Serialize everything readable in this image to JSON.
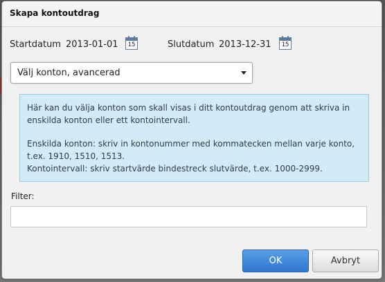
{
  "dialog": {
    "title": "Skapa kontoutdrag"
  },
  "dates": {
    "start_label": "Startdatum",
    "start_value": "2013-01-01",
    "end_label": "Slutdatum",
    "end_value": "2013-12-31",
    "calendar_icon_number": "15"
  },
  "account_select": {
    "selected": "Välj konton, avancerad"
  },
  "info": {
    "line1": "Här kan du välja konton som skall visas i ditt kontoutdrag genom att skriva in",
    "line2": "enskilda konton eller ett kontointervall.",
    "line3": "Enskilda konton: skriv in kontonummer med kommatecken mellan varje konto,",
    "line4": "t.ex. 1910, 1510, 1513.",
    "line5": "Kontointervall: skriv startvärde bindestreck slutvärde, t.ex. 1000-2999."
  },
  "filter": {
    "label": "Filter:",
    "value": ""
  },
  "buttons": {
    "ok": "OK",
    "cancel": "Avbryt"
  },
  "colors": {
    "primary_button": "#2f77d1",
    "info_background": "#d3ebf7"
  }
}
